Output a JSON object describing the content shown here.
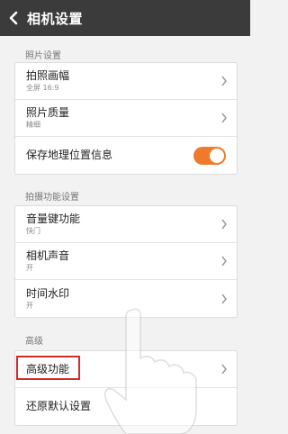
{
  "header": {
    "title": "相机设置"
  },
  "sections": [
    {
      "title": "照片设置",
      "items": [
        {
          "label": "拍照画幅",
          "value": "全屏 16:9"
        },
        {
          "label": "照片质量",
          "value": "精细"
        },
        {
          "label": "保存地理位置信息",
          "toggle": true
        }
      ]
    },
    {
      "title": "拍摄功能设置",
      "items": [
        {
          "label": "音量键功能",
          "value": "快门"
        },
        {
          "label": "相机声音",
          "value": "开"
        },
        {
          "label": "时间水印",
          "value": "开"
        }
      ]
    },
    {
      "title": "高级",
      "items": [
        {
          "label": "高级功能"
        },
        {
          "label": "还原默认设置"
        }
      ]
    }
  ],
  "colors": {
    "accent": "#f07a2c",
    "highlight": "#d42a2a",
    "topbar": "#3b3b3b"
  }
}
